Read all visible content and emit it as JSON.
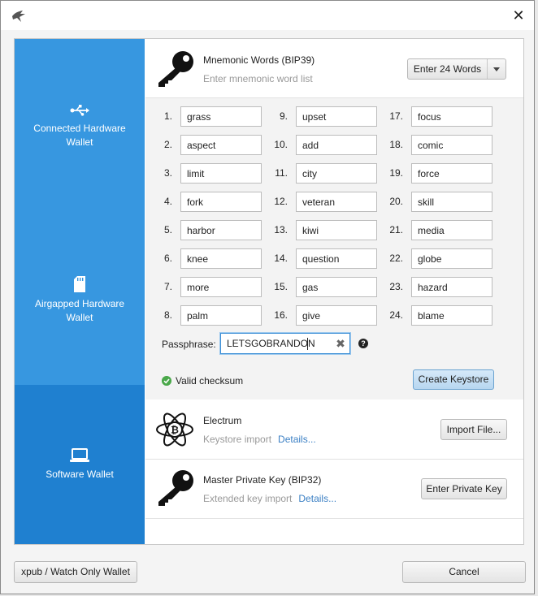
{
  "window": {
    "close_glyph": "✕"
  },
  "sidebar": {
    "items": [
      {
        "label": "Connected Hardware Wallet",
        "icon": "usb-icon"
      },
      {
        "label": "Airgapped Hardware Wallet",
        "icon": "sd-card-icon"
      },
      {
        "label": "Software Wallet",
        "icon": "laptop-icon"
      }
    ]
  },
  "mnemonic": {
    "title": "Mnemonic Words (BIP39)",
    "subtitle": "Enter mnemonic word list",
    "word_count_button": "Enter 24 Words",
    "words": [
      {
        "num": "1.",
        "word": "grass"
      },
      {
        "num": "2.",
        "word": "aspect"
      },
      {
        "num": "3.",
        "word": "limit"
      },
      {
        "num": "4.",
        "word": "fork"
      },
      {
        "num": "5.",
        "word": "harbor"
      },
      {
        "num": "6.",
        "word": "knee"
      },
      {
        "num": "7.",
        "word": "more"
      },
      {
        "num": "8.",
        "word": "palm"
      },
      {
        "num": "9.",
        "word": "upset"
      },
      {
        "num": "10.",
        "word": "add"
      },
      {
        "num": "11.",
        "word": "city"
      },
      {
        "num": "12.",
        "word": "veteran"
      },
      {
        "num": "13.",
        "word": "kiwi"
      },
      {
        "num": "14.",
        "word": "question"
      },
      {
        "num": "15.",
        "word": "gas"
      },
      {
        "num": "16.",
        "word": "give"
      },
      {
        "num": "17.",
        "word": "focus"
      },
      {
        "num": "18.",
        "word": "comic"
      },
      {
        "num": "19.",
        "word": "force"
      },
      {
        "num": "20.",
        "word": "skill"
      },
      {
        "num": "21.",
        "word": "media"
      },
      {
        "num": "22.",
        "word": "globe"
      },
      {
        "num": "23.",
        "word": "hazard"
      },
      {
        "num": "24.",
        "word": "blame"
      }
    ],
    "passphrase_label": "Passphrase:",
    "passphrase_value": "LETSGOBRANDON",
    "checksum_text": "Valid checksum",
    "create_button": "Create Keystore"
  },
  "electrum": {
    "title": "Electrum",
    "subtitle": "Keystore import",
    "details_link": "Details...",
    "button": "Import File..."
  },
  "master_key": {
    "title": "Master Private Key (BIP32)",
    "subtitle": "Extended key import",
    "details_link": "Details...",
    "button": "Enter Private Key"
  },
  "footer": {
    "watch_only_button": "xpub / Watch Only Wallet",
    "cancel_button": "Cancel"
  },
  "colors": {
    "sidebar": "#3797e0",
    "sidebar_active": "#1f80d0",
    "link": "#3a7fc4",
    "valid": "#4aa84a"
  }
}
